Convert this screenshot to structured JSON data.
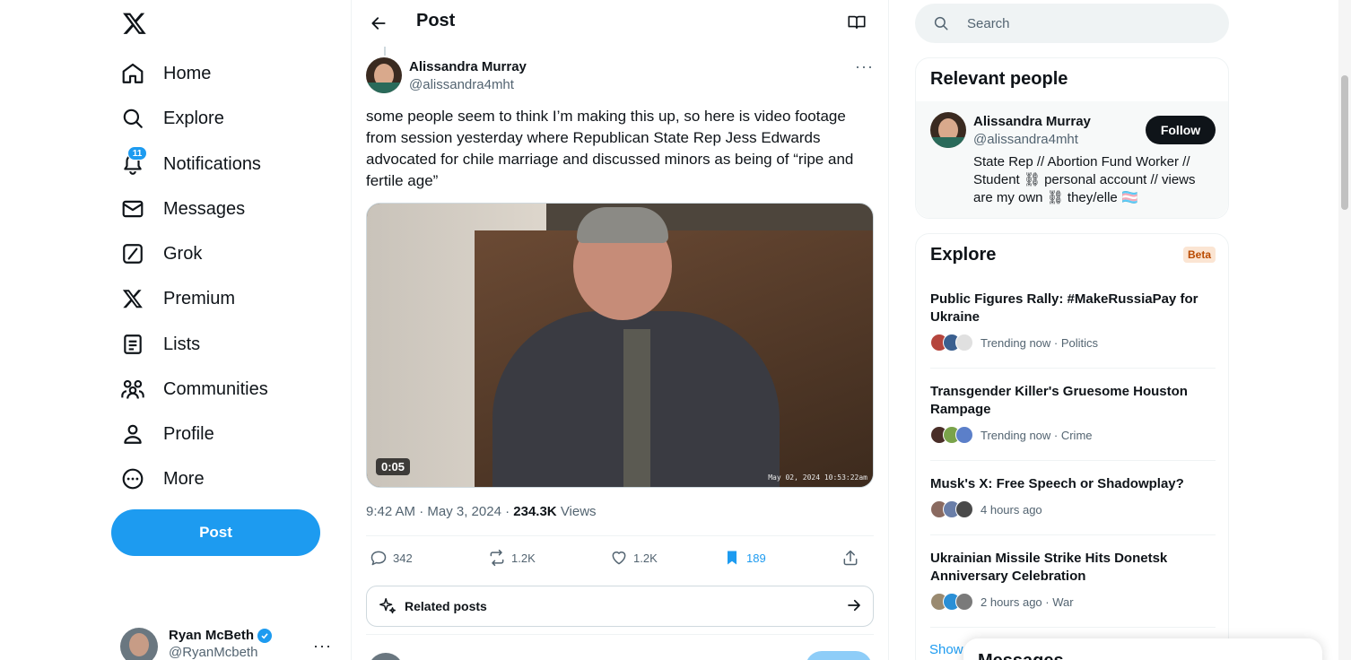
{
  "nav": {
    "logo": "X",
    "items": [
      {
        "label": "Home",
        "icon": "home-icon"
      },
      {
        "label": "Explore",
        "icon": "search-icon"
      },
      {
        "label": "Notifications",
        "icon": "bell-icon",
        "badge": "11"
      },
      {
        "label": "Messages",
        "icon": "envelope-icon"
      },
      {
        "label": "Grok",
        "icon": "grok-icon"
      },
      {
        "label": "Premium",
        "icon": "x-icon"
      },
      {
        "label": "Lists",
        "icon": "list-icon"
      },
      {
        "label": "Communities",
        "icon": "people-icon"
      },
      {
        "label": "Profile",
        "icon": "person-icon"
      },
      {
        "label": "More",
        "icon": "more-circle-icon"
      }
    ],
    "post_button": "Post",
    "account": {
      "name": "Ryan McBeth",
      "handle": "@RyanMcbeth",
      "verified": true
    }
  },
  "header": {
    "title": "Post"
  },
  "post": {
    "author_name": "Alissandra Murray",
    "author_handle": "@alissandra4mht",
    "text": "some people seem to think I’m making this up, so here is video footage from session yesterday where Republican State Rep Jess Edwards advocated for chile marriage and discussed minors as being of “ripe and fertile age”",
    "video": {
      "duration": "0:05",
      "timestamp": "May 02, 2024 10:53:22am"
    },
    "time": "9:42 AM · May 3, 2024",
    "views_count": "234.3K",
    "views_label": "Views",
    "replies": "342",
    "reposts": "1.2K",
    "likes": "1.2K",
    "bookmarks": "189",
    "related_label": "Related posts"
  },
  "search": {
    "placeholder": "Search"
  },
  "relevant": {
    "title": "Relevant people",
    "person": {
      "name": "Alissandra Murray",
      "handle": "@alissandra4mht",
      "bio": "State Rep // Abortion Fund Worker // Student ⛓ personal account // views are my own ⛓ they/elle 🏳️‍⚧️",
      "follow_label": "Follow"
    }
  },
  "explore": {
    "title": "Explore",
    "badge": "Beta",
    "trends": [
      {
        "title": "Public Figures Rally: #MakeRussiaPay for Ukraine",
        "meta": "Trending now · Politics",
        "faces": [
          "#b5453d",
          "#3a5f8f",
          "#e0e0e0"
        ]
      },
      {
        "title": "Transgender Killer's Gruesome Houston Rampage",
        "meta": "Trending now · Crime",
        "faces": [
          "#4a2e28",
          "#7aa34a",
          "#5b7fc9"
        ]
      },
      {
        "title": "Musk's X: Free Speech or Shadowplay?",
        "meta": "4 hours ago",
        "faces": [
          "#8a6a60",
          "#6a7ea8",
          "#4a4a4a"
        ]
      },
      {
        "title": "Ukrainian Missile Strike Hits Donetsk Anniversary Celebration",
        "meta": "2 hours ago · War",
        "faces": [
          "#9a8a70",
          "#2a8fd6",
          "#7a7a7a"
        ]
      }
    ],
    "show_more": "Show"
  },
  "messages_drawer": {
    "label": "Messages"
  },
  "colors": {
    "accent": "#1d9bf0",
    "text": "#0f1419",
    "muted": "#536471",
    "bookmark_active": "#1d9bf0"
  }
}
